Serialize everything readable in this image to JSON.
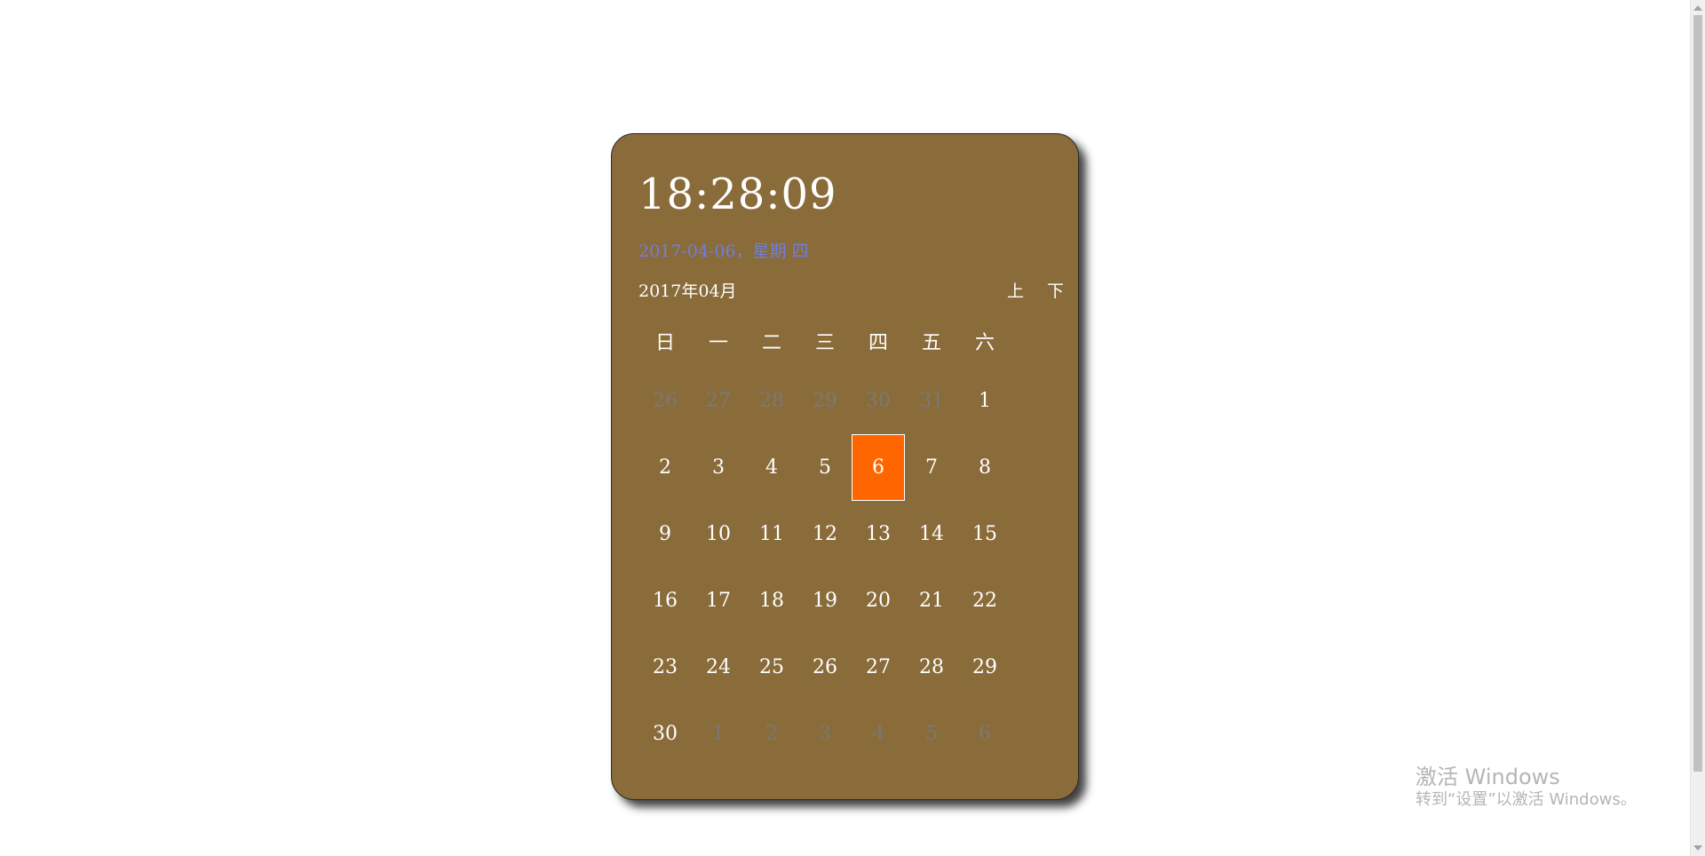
{
  "clock": {
    "time": "18:28:09"
  },
  "date_line": "2017-04-06，星期 四",
  "header": {
    "month_label": "2017年04月",
    "prev_label": "上",
    "next_label": "下"
  },
  "weekdays": [
    "日",
    "一",
    "二",
    "三",
    "四",
    "五",
    "六"
  ],
  "weeks": [
    [
      {
        "d": "26",
        "m": true
      },
      {
        "d": "27",
        "m": true
      },
      {
        "d": "28",
        "m": true
      },
      {
        "d": "29",
        "m": true
      },
      {
        "d": "30",
        "m": true
      },
      {
        "d": "31",
        "m": true
      },
      {
        "d": "1"
      }
    ],
    [
      {
        "d": "2"
      },
      {
        "d": "3"
      },
      {
        "d": "4"
      },
      {
        "d": "5"
      },
      {
        "d": "6",
        "today": true
      },
      {
        "d": "7"
      },
      {
        "d": "8"
      }
    ],
    [
      {
        "d": "9"
      },
      {
        "d": "10"
      },
      {
        "d": "11"
      },
      {
        "d": "12"
      },
      {
        "d": "13"
      },
      {
        "d": "14"
      },
      {
        "d": "15"
      }
    ],
    [
      {
        "d": "16"
      },
      {
        "d": "17"
      },
      {
        "d": "18"
      },
      {
        "d": "19"
      },
      {
        "d": "20"
      },
      {
        "d": "21"
      },
      {
        "d": "22"
      }
    ],
    [
      {
        "d": "23"
      },
      {
        "d": "24"
      },
      {
        "d": "25"
      },
      {
        "d": "26"
      },
      {
        "d": "27"
      },
      {
        "d": "28"
      },
      {
        "d": "29"
      }
    ],
    [
      {
        "d": "30"
      },
      {
        "d": "1",
        "m": true
      },
      {
        "d": "2",
        "m": true
      },
      {
        "d": "3",
        "m": true
      },
      {
        "d": "4",
        "m": true
      },
      {
        "d": "5",
        "m": true
      },
      {
        "d": "6",
        "m": true
      }
    ]
  ],
  "colors": {
    "card_bg": "#8a6b3a",
    "today_bg": "#ff6600",
    "date_line": "#6f7fe0",
    "muted_day": "#7a7a72"
  },
  "watermark": {
    "title": "激活 Windows",
    "subtitle": "转到“设置”以激活 Windows。"
  }
}
